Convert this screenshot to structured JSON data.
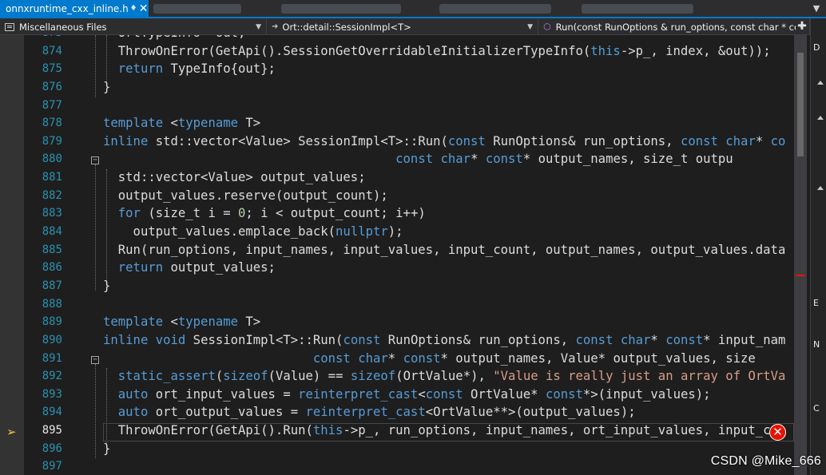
{
  "tabs": {
    "active": {
      "label": "onnxruntime_cxx_inline.h",
      "pin_icon": "pin-icon",
      "close_icon": "close-icon"
    },
    "others": [
      {
        "label": "",
        "obscured": true
      },
      {
        "label": "",
        "obscured": true
      },
      {
        "label": "",
        "obscured": true
      },
      {
        "label": "",
        "obscured": true
      }
    ],
    "overflow_icon": "tab-overflow-icon"
  },
  "navigation": {
    "project": "Miscellaneous Files",
    "scope": "Ort::detail::SessionImpl<T>",
    "member": "Run(const RunOptions & run_options, const char * const"
  },
  "editor": {
    "current_line": 895,
    "lines": [
      {
        "n": "873",
        "tokens": [
          {
            "t": "  OrtTypeInfo* out;"
          }
        ]
      },
      {
        "n": "874",
        "tokens": [
          {
            "t": "  ThrowOnError(GetApi().SessionGetOverridableInitializerTypeInfo("
          },
          {
            "t": "this",
            "c": "k"
          },
          {
            "t": "->p_, index, &out));"
          }
        ]
      },
      {
        "n": "875",
        "tokens": [
          {
            "t": "  "
          },
          {
            "t": "return",
            "c": "k"
          },
          {
            "t": " TypeInfo{out};"
          }
        ]
      },
      {
        "n": "876",
        "tokens": [
          {
            "t": "}"
          }
        ]
      },
      {
        "n": "877",
        "tokens": [
          {
            "t": ""
          }
        ]
      },
      {
        "n": "878",
        "tokens": [
          {
            "t": "template",
            "c": "k"
          },
          {
            "t": " <"
          },
          {
            "t": "typename",
            "c": "k"
          },
          {
            "t": " T>"
          }
        ]
      },
      {
        "n": "879",
        "tokens": [
          {
            "t": "inline",
            "c": "k"
          },
          {
            "t": " std::vector<Value> SessionImpl<T>::Run("
          },
          {
            "t": "const",
            "c": "k"
          },
          {
            "t": " RunOptions& run_options, "
          },
          {
            "t": "const",
            "c": "k"
          },
          {
            "t": " "
          },
          {
            "t": "char",
            "c": "k"
          },
          {
            "t": "* "
          },
          {
            "t": "co",
            "c": "k"
          }
        ]
      },
      {
        "n": "880",
        "tokens": [
          {
            "t": "                                       "
          },
          {
            "t": "const",
            "c": "k"
          },
          {
            "t": " "
          },
          {
            "t": "char",
            "c": "k"
          },
          {
            "t": "* "
          },
          {
            "t": "const",
            "c": "k"
          },
          {
            "t": "* output_names, size_t outpu"
          }
        ]
      },
      {
        "n": "881",
        "tokens": [
          {
            "t": "  std::vector<Value> output_values;"
          }
        ]
      },
      {
        "n": "882",
        "tokens": [
          {
            "t": "  output_values.reserve(output_count);"
          }
        ]
      },
      {
        "n": "883",
        "tokens": [
          {
            "t": "  "
          },
          {
            "t": "for",
            "c": "k"
          },
          {
            "t": " (size_t i = "
          },
          {
            "t": "0",
            "c": "n"
          },
          {
            "t": "; i < output_count; i++)"
          }
        ]
      },
      {
        "n": "884",
        "tokens": [
          {
            "t": "    output_values.emplace_back("
          },
          {
            "t": "nullptr",
            "c": "k"
          },
          {
            "t": ");"
          }
        ]
      },
      {
        "n": "885",
        "tokens": [
          {
            "t": "  Run(run_options, input_names, input_values, input_count, output_names, output_values.data"
          }
        ]
      },
      {
        "n": "886",
        "tokens": [
          {
            "t": "  "
          },
          {
            "t": "return",
            "c": "k"
          },
          {
            "t": " output_values;"
          }
        ]
      },
      {
        "n": "887",
        "tokens": [
          {
            "t": "}"
          }
        ]
      },
      {
        "n": "888",
        "tokens": [
          {
            "t": ""
          }
        ]
      },
      {
        "n": "889",
        "tokens": [
          {
            "t": "template",
            "c": "k"
          },
          {
            "t": " <"
          },
          {
            "t": "typename",
            "c": "k"
          },
          {
            "t": " T>"
          }
        ]
      },
      {
        "n": "890",
        "tokens": [
          {
            "t": "inline",
            "c": "k"
          },
          {
            "t": " "
          },
          {
            "t": "void",
            "c": "k"
          },
          {
            "t": " SessionImpl<T>::Run("
          },
          {
            "t": "const",
            "c": "k"
          },
          {
            "t": " RunOptions& run_options, "
          },
          {
            "t": "const",
            "c": "k"
          },
          {
            "t": " "
          },
          {
            "t": "char",
            "c": "k"
          },
          {
            "t": "* "
          },
          {
            "t": "const",
            "c": "k"
          },
          {
            "t": "* input_nam"
          }
        ]
      },
      {
        "n": "891",
        "tokens": [
          {
            "t": "                            "
          },
          {
            "t": "const",
            "c": "k"
          },
          {
            "t": " "
          },
          {
            "t": "char",
            "c": "k"
          },
          {
            "t": "* "
          },
          {
            "t": "const",
            "c": "k"
          },
          {
            "t": "* output_names, Value* output_values, size"
          }
        ]
      },
      {
        "n": "892",
        "tokens": [
          {
            "t": "  "
          },
          {
            "t": "static_assert",
            "c": "k"
          },
          {
            "t": "("
          },
          {
            "t": "sizeof",
            "c": "k"
          },
          {
            "t": "(Value) == "
          },
          {
            "t": "sizeof",
            "c": "k"
          },
          {
            "t": "(OrtValue*), "
          },
          {
            "t": "\"Value is really just an array of OrtVa",
            "c": "s"
          }
        ]
      },
      {
        "n": "893",
        "tokens": [
          {
            "t": "  "
          },
          {
            "t": "auto",
            "c": "k"
          },
          {
            "t": " ort_input_values = "
          },
          {
            "t": "reinterpret_cast",
            "c": "k"
          },
          {
            "t": "<"
          },
          {
            "t": "const",
            "c": "k"
          },
          {
            "t": " OrtValue* "
          },
          {
            "t": "const",
            "c": "k"
          },
          {
            "t": "*>(input_values);"
          }
        ]
      },
      {
        "n": "894",
        "tokens": [
          {
            "t": "  "
          },
          {
            "t": "auto",
            "c": "k"
          },
          {
            "t": " ort_output_values = "
          },
          {
            "t": "reinterpret_cast",
            "c": "k"
          },
          {
            "t": "<OrtValue**>(output_values);"
          }
        ]
      },
      {
        "n": "895",
        "tokens": [
          {
            "t": "  ThrowOnError(GetApi().Run("
          },
          {
            "t": "this",
            "c": "k"
          },
          {
            "t": "->p_, run_options, input_names, ort_input_values, input_cou"
          }
        ]
      },
      {
        "n": "896",
        "tokens": [
          {
            "t": "}"
          }
        ]
      },
      {
        "n": "897",
        "tokens": [
          {
            "t": ""
          }
        ]
      }
    ]
  },
  "icons": {
    "pointer": "current-statement-arrow-icon",
    "error": "error-icon",
    "split": "split-editor-icon"
  },
  "right_strip_letters": [
    "D",
    "E",
    "N",
    "C"
  ],
  "watermark": "CSDN @Mike_666"
}
